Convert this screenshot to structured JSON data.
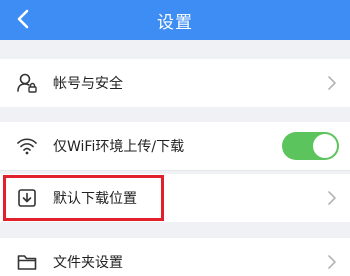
{
  "header": {
    "title": "设置",
    "back_icon": "chevron-left-icon"
  },
  "settings": {
    "account": {
      "label": "帐号与安全",
      "icon": "user-lock-icon"
    },
    "wifi_only": {
      "label": "仅WiFi环境上传/下载",
      "icon": "wifi-icon",
      "toggle_on": true
    },
    "download_location": {
      "label": "默认下载位置",
      "icon": "download-box-icon"
    },
    "folder_settings": {
      "label": "文件夹设置",
      "icon": "folder-icon"
    }
  },
  "colors": {
    "header_bg": "#3e8df5",
    "toggle_on": "#5cc45c",
    "highlight": "#e0202a",
    "page_bg": "#f0f1f4"
  }
}
